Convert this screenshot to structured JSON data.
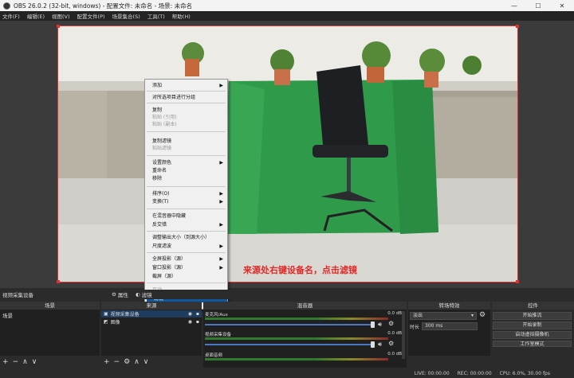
{
  "window": {
    "title": "OBS 26.0.2 (32-bit, windows) - 配置文件: 未命名 - 场景: 未命名",
    "min": "—",
    "max": "☐",
    "close": "✕"
  },
  "menu": [
    "文件(F)",
    "编辑(E)",
    "视图(V)",
    "配置文件(P)",
    "场景集合(S)",
    "工具(T)",
    "帮助(H)"
  ],
  "caption": "来源处右键设备名，点击滤镜",
  "context_menu": [
    {
      "label": "添加",
      "sub": true
    },
    {
      "label": "对所选项目进行分组"
    },
    {
      "label": "复制"
    },
    {
      "label": "粘贴 (引用)",
      "disabled": true
    },
    {
      "label": "粘贴 (副本)",
      "disabled": true
    },
    {
      "label": "复制滤镜"
    },
    {
      "label": "粘贴滤镜",
      "disabled": true
    },
    {
      "label": "设置颜色",
      "sub": true
    },
    {
      "label": "重命名"
    },
    {
      "label": "移除"
    },
    {
      "label": "排序(O)",
      "sub": true
    },
    {
      "label": "变换(T)",
      "sub": true
    },
    {
      "label": "在混音器中隐藏"
    },
    {
      "label": "反交错",
      "sub": true
    },
    {
      "label": "调整输出大小（到源大小）"
    },
    {
      "label": "尺度滤波",
      "sub": true
    },
    {
      "label": "全屏投影（源）",
      "sub": true
    },
    {
      "label": "窗口投影（源）"
    },
    {
      "label": "截屏（源）"
    },
    {
      "label": "互动",
      "disabled": true
    },
    {
      "label": "滤镜",
      "highlighted": true
    },
    {
      "label": "属性"
    }
  ],
  "source_bar": {
    "name": "视频采集设备",
    "properties": "属性",
    "filters": "滤镜"
  },
  "docks": {
    "scenes": {
      "title": "场景",
      "items": [
        "场景"
      ]
    },
    "sources": {
      "title": "来源",
      "items": [
        "视频采集设备",
        "图像"
      ]
    },
    "mixer": {
      "title": "混音器",
      "tracks": [
        {
          "name": "麦克风/Aux",
          "db": "0.0 dB"
        },
        {
          "name": "视频采集设备",
          "db": "0.0 dB"
        },
        {
          "name": "桌面音频",
          "db": "0.0 dB"
        }
      ]
    },
    "transitions": {
      "title": "转场特效",
      "selected": "淡出",
      "duration_label": "时长",
      "duration": "300 ms"
    },
    "controls": {
      "title": "控件",
      "buttons": [
        "开始推流",
        "开始录制",
        "启动虚拟摄像机",
        "工作室模式"
      ]
    }
  },
  "status": {
    "live": "LIVE: 00:00:00",
    "rec": "REC: 00:00:00",
    "cpu": "CPU: 6.0%, 30.00 fps"
  }
}
